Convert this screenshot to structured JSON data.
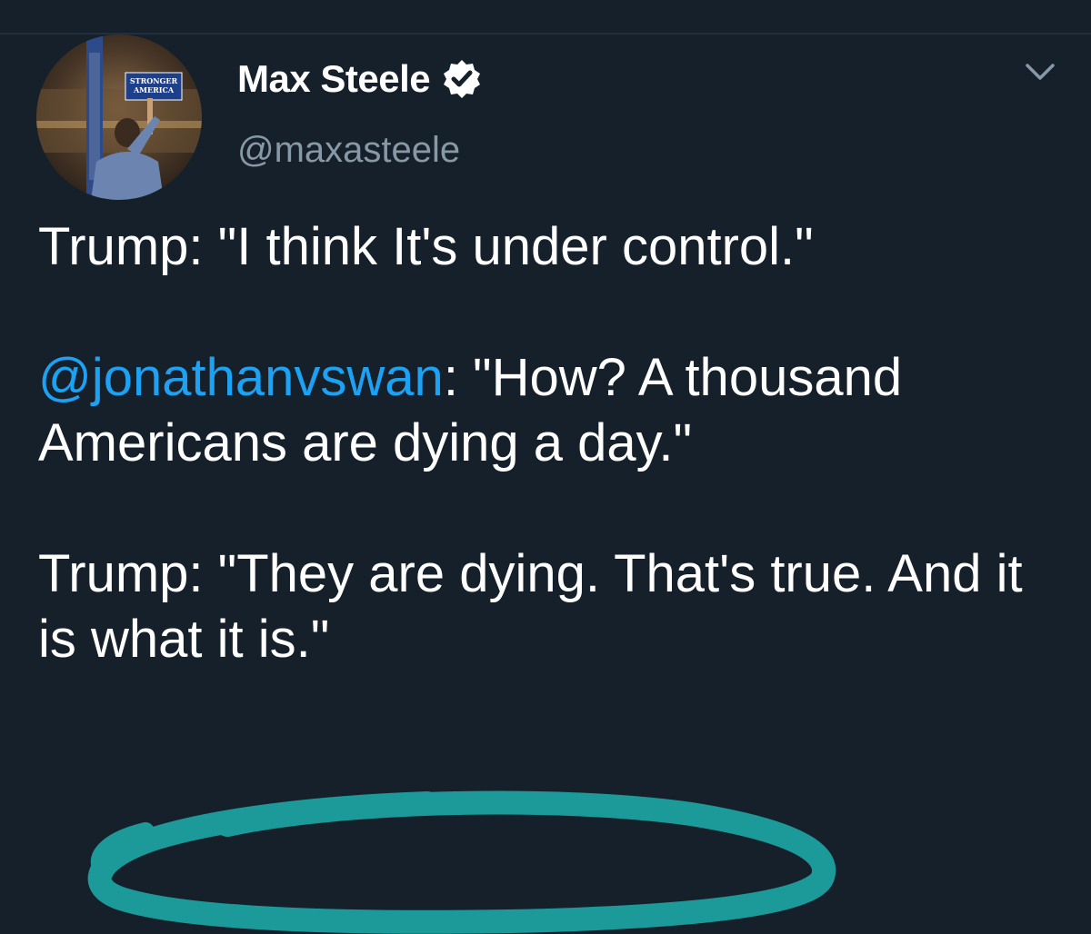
{
  "tweet": {
    "author": {
      "display_name": "Max Steele",
      "handle": "@maxasteele",
      "verified": true,
      "avatar_sign_text": "STRONGER AMERICA"
    },
    "menu_icon": "chevron-down-icon",
    "verified_icon": "verified-badge-icon",
    "text": {
      "line1": "Trump: \"I think It's under control.\"",
      "mention": "@jonathanvswan",
      "line2_rest": ": \"How? A thousand Americans are dying a day.\"",
      "line3_part1": "Trump: \"They are dying. That's true.",
      "line3_part2": " And it is what it is.\""
    },
    "annotation": {
      "type": "hand-drawn ellipse",
      "color": "#1c9a9a"
    }
  },
  "colors": {
    "background": "#15202b",
    "primary_text": "#ffffff",
    "secondary_text": "#8899a6",
    "link": "#1da1f2"
  }
}
